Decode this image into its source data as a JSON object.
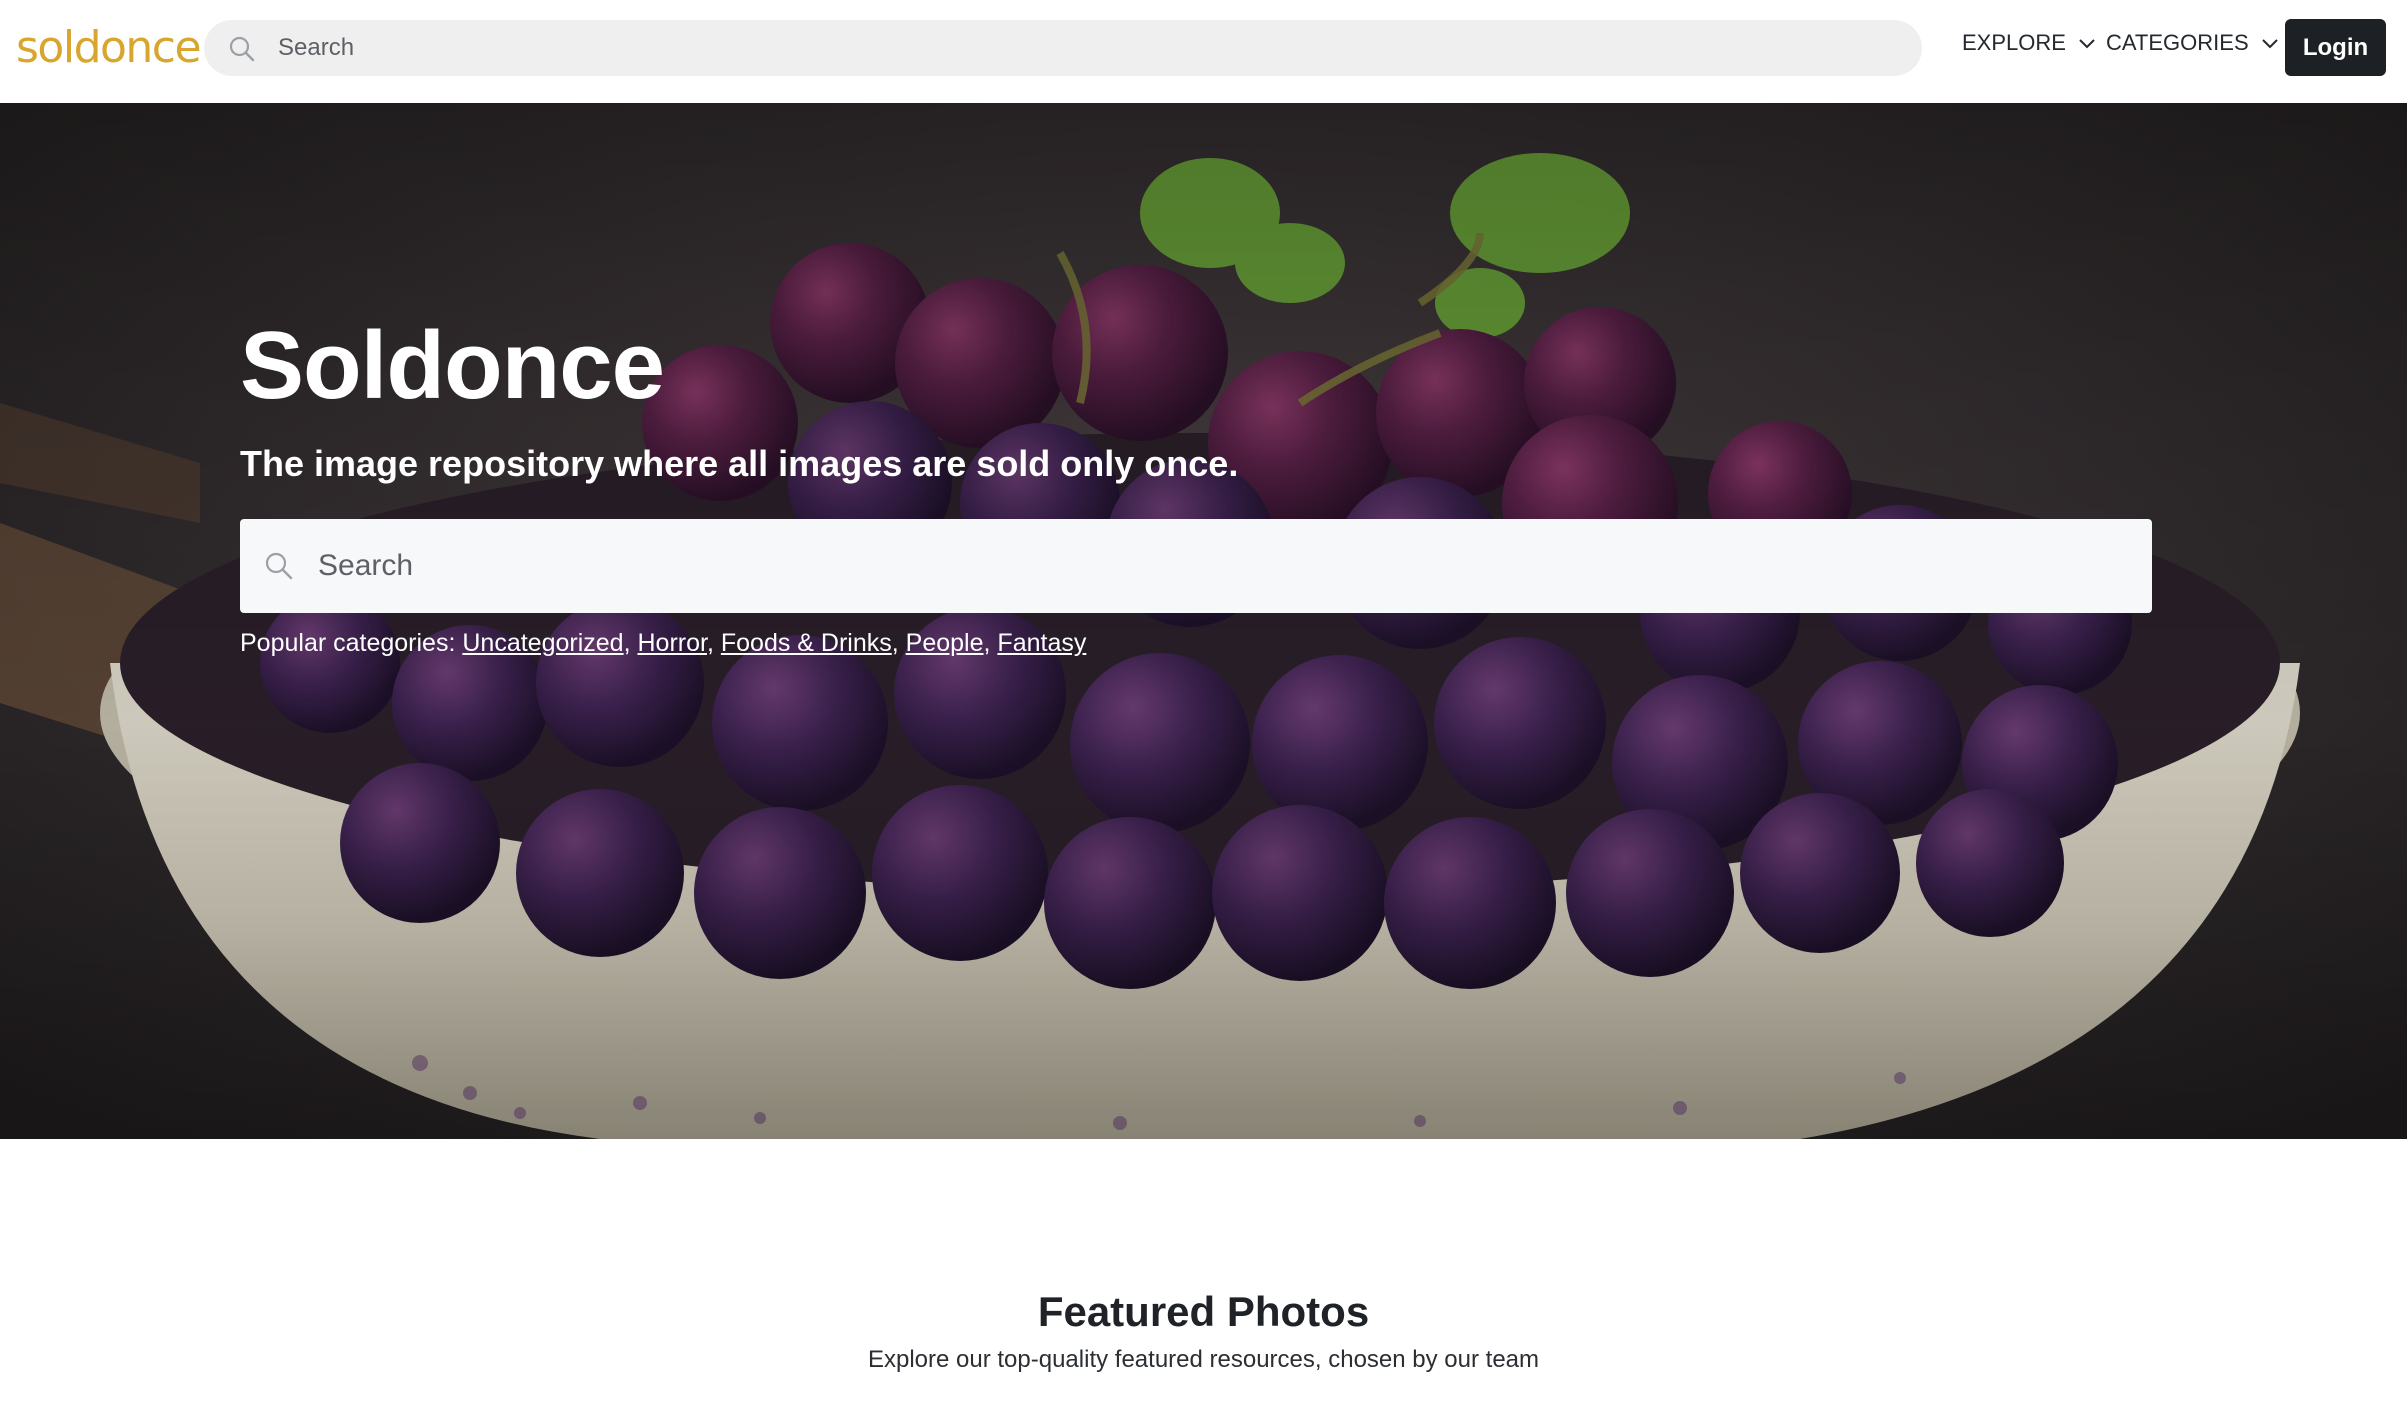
{
  "header": {
    "logo": "soldonce",
    "search_placeholder": "Search",
    "nav": {
      "explore": "EXPLORE",
      "categories": "CATEGORIES"
    },
    "login_label": "Login"
  },
  "hero": {
    "title": "Soldonce",
    "subtitle": "The image repository where all images are sold only once.",
    "search_placeholder": "Search",
    "popular_label": "Popular categories:",
    "popular_categories": [
      "Uncategorized",
      "Horror",
      "Foods & Drinks",
      "People",
      "Fantasy"
    ]
  },
  "featured": {
    "title": "Featured Photos",
    "subtitle": "Explore our top-quality featured resources, chosen by our team"
  },
  "colors": {
    "logo": "#d8a62c",
    "login_bg": "#1d2125",
    "search_bg": "#efefef"
  }
}
